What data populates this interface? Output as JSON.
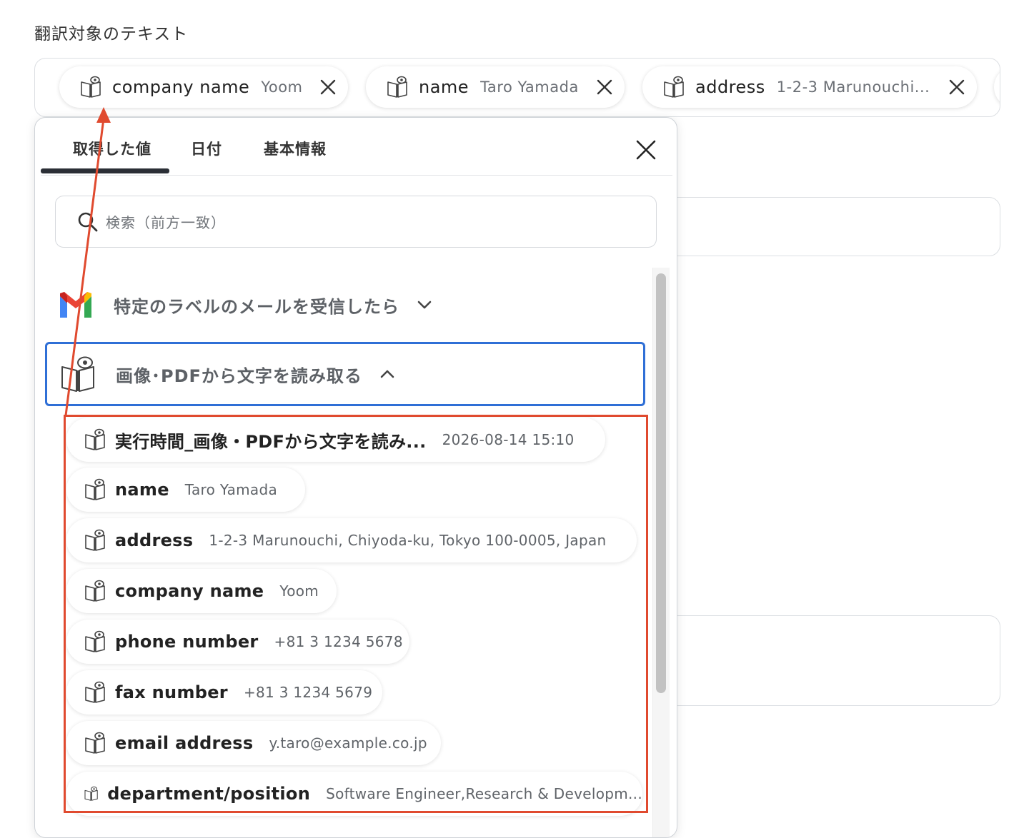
{
  "section_title": "翻訳対象のテキスト",
  "selected_chips": [
    {
      "label": "company name",
      "value": "Yoom"
    },
    {
      "label": "name",
      "value": "Taro Yamada"
    },
    {
      "label": "address",
      "value": "1-2-3 Marunouchi..."
    }
  ],
  "popup": {
    "tabs": [
      {
        "label": "取得した値",
        "active": true
      },
      {
        "label": "日付",
        "active": false
      },
      {
        "label": "基本情報",
        "active": false
      }
    ],
    "search_placeholder": "検索（前方一致）",
    "groups": [
      {
        "label": "特定のラベルのメールを受信したら",
        "icon": "gmail-icon",
        "expanded": false
      },
      {
        "label": "画像･PDFから文字を読み取る",
        "icon": "ocr-book-icon",
        "expanded": true
      }
    ],
    "items": [
      {
        "label": "実行時間_画像・PDFから文字を読み...",
        "value": "2026-08-14 15:10"
      },
      {
        "label": "name",
        "value": "Taro Yamada"
      },
      {
        "label": "address",
        "value": "1-2-3 Marunouchi, Chiyoda-ku, Tokyo 100-0005, Japan"
      },
      {
        "label": "company name",
        "value": "Yoom"
      },
      {
        "label": "phone number",
        "value": "+81 3 1234 5678"
      },
      {
        "label": "fax number",
        "value": "+81 3 1234 5679"
      },
      {
        "label": "email address",
        "value": "y.taro@example.co.jp"
      },
      {
        "label": "department/position",
        "value": "Software Engineer,Research & Developm..."
      }
    ]
  },
  "colors": {
    "highlight_red": "#e04a2f",
    "active_blue": "#2f6fd6"
  }
}
